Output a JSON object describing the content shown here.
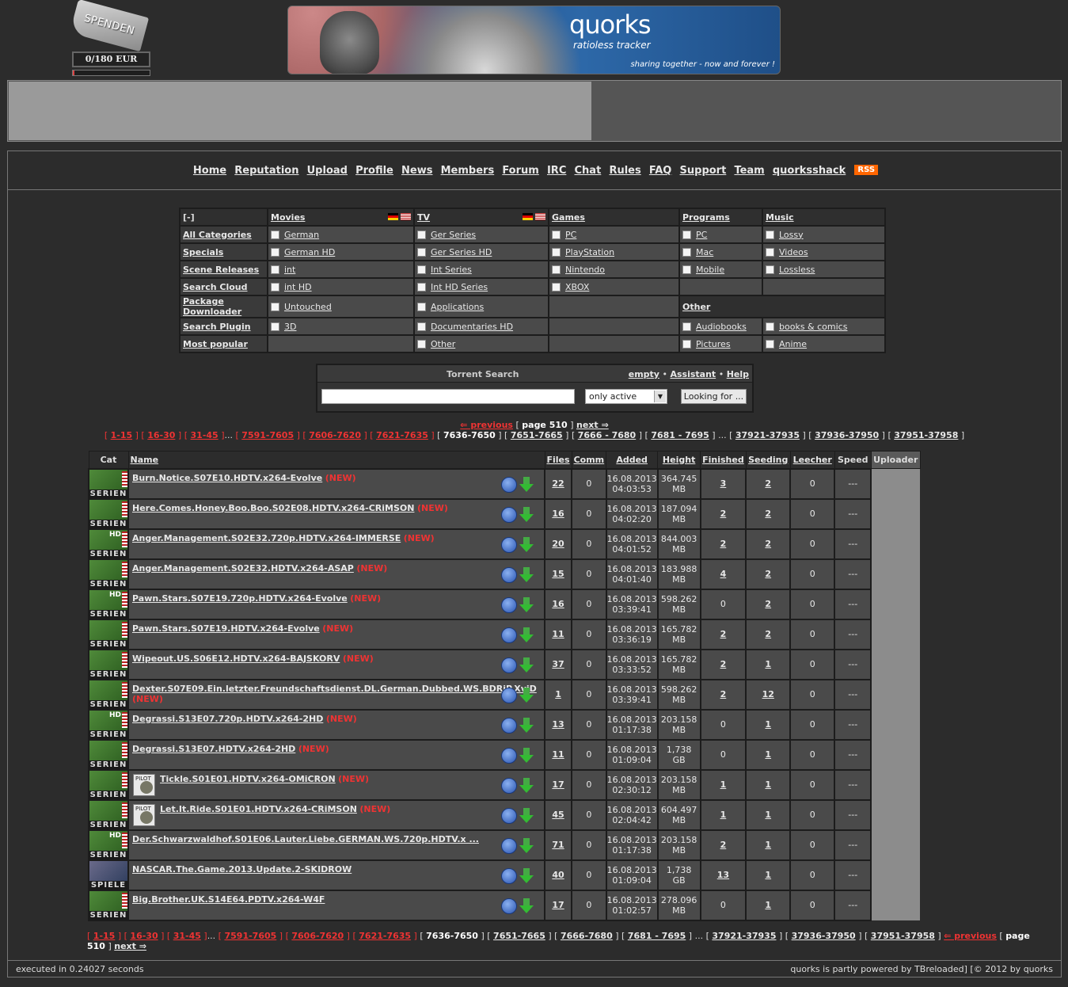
{
  "donate": {
    "tag": "SPENDEN",
    "amount": "0/180 EUR",
    "progress": 0.0
  },
  "banner": {
    "title": "quorks",
    "subtitle": "ratioless tracker",
    "slogan": "sharing together - now and forever !"
  },
  "nav": {
    "items": [
      "Home",
      "Reputation",
      "Upload",
      "Profile",
      "News",
      "Members",
      "Forum",
      "IRC",
      "Chat",
      "Rules",
      "FAQ",
      "Support",
      "Team",
      "quorksshack"
    ],
    "rss": "RSS"
  },
  "categories": {
    "toggle": "[-]",
    "headers": {
      "movies": "Movies",
      "tv": "TV",
      "games": "Games",
      "programs": "Programs",
      "music": "Music",
      "other": "Other"
    },
    "links": [
      "All Categories",
      "Specials",
      "Scene Releases",
      "Search Cloud",
      "Package Downloader",
      "Search Plugin",
      "Most popular"
    ],
    "movies": [
      "German",
      "German HD",
      "int",
      "int HD",
      "Untouched",
      "3D"
    ],
    "tv": [
      "Ger Series",
      "Ger Series HD",
      "Int Series",
      "Int HD Series",
      "Applications",
      "Documentaries HD",
      "Other"
    ],
    "games": [
      "PC",
      "PlayStation",
      "Nintendo",
      "XBOX"
    ],
    "programs": [
      "PC",
      "Mac",
      "Mobile"
    ],
    "music": [
      "Lossy",
      "Videos",
      "Lossless"
    ],
    "other_left": [
      "Audiobooks",
      "Pictures"
    ],
    "other_right": [
      "books & comics",
      "Anime"
    ]
  },
  "search": {
    "title": "Torrent Search",
    "empty": "empty",
    "assistant": "Assistant",
    "help": "Help",
    "sep": "•",
    "select_value": "only active",
    "button": "Looking for ..."
  },
  "pager": {
    "previous": "⇐ previous",
    "page": "page 510",
    "next": "next ⇒",
    "red_pages": [
      "1-15",
      "16-30",
      "31-45",
      "7591-7605",
      "7606-7620",
      "7621-7635"
    ],
    "current": "7636-7650",
    "top_pages": [
      "7651-7665",
      "7666 - 7680",
      "7681 - 7695",
      "37921-37935",
      "37936-37950",
      "37951-37958"
    ],
    "bottom_pages": [
      "7651-7665",
      "7666-7680",
      "7681 - 7695",
      "37921-37935",
      "37936-37950",
      "37951-37958"
    ],
    "ellipsis": "..."
  },
  "table": {
    "headers": [
      "Cat",
      "Name",
      "Files",
      "Comm",
      "Added",
      "Height",
      "Finished",
      "Seeding",
      "Leecher",
      "Speed",
      "Uploader"
    ],
    "new_label": "(NEW)",
    "rows": [
      {
        "cat": "SERIEN",
        "hd": "",
        "name": "Burn.Notice.S07E10.HDTV.x264-Evolve",
        "new": true,
        "files": "22",
        "comm": "0",
        "date": "16.08.2013",
        "time": "04:03:53",
        "size": "364.745",
        "unit": "MB",
        "finished": "3",
        "seeding": "2",
        "leecher": "0",
        "speed": "---"
      },
      {
        "cat": "SERIEN",
        "hd": "",
        "name": "Here.Comes.Honey.Boo.Boo.S02E08.HDTV.x264-CRiMSON",
        "new": true,
        "files": "16",
        "comm": "0",
        "date": "16.08.2013",
        "time": "04:02:20",
        "size": "187.094",
        "unit": "MB",
        "finished": "2",
        "seeding": "2",
        "leecher": "0",
        "speed": "---"
      },
      {
        "cat": "SERIEN",
        "hd": "HD",
        "name": "Anger.Management.S02E32.720p.HDTV.x264-IMMERSE",
        "new": true,
        "files": "20",
        "comm": "0",
        "date": "16.08.2013",
        "time": "04:01:52",
        "size": "844.003",
        "unit": "MB",
        "finished": "2",
        "seeding": "2",
        "leecher": "0",
        "speed": "---"
      },
      {
        "cat": "SERIEN",
        "hd": "",
        "name": "Anger.Management.S02E32.HDTV.x264-ASAP",
        "new": true,
        "files": "15",
        "comm": "0",
        "date": "16.08.2013",
        "time": "04:01:40",
        "size": "183.988",
        "unit": "MB",
        "finished": "4",
        "seeding": "2",
        "leecher": "0",
        "speed": "---"
      },
      {
        "cat": "SERIEN",
        "hd": "HD",
        "name": "Pawn.Stars.S07E19.720p.HDTV.x264-Evolve",
        "new": true,
        "files": "16",
        "comm": "0",
        "date": "16.08.2013",
        "time": "03:39:41",
        "size": "598.262",
        "unit": "MB",
        "finished": "0",
        "seeding": "2",
        "leecher": "0",
        "speed": "---"
      },
      {
        "cat": "SERIEN",
        "hd": "",
        "name": "Pawn.Stars.S07E19.HDTV.x264-Evolve",
        "new": true,
        "files": "11",
        "comm": "0",
        "date": "16.08.2013",
        "time": "03:36:19",
        "size": "165.782",
        "unit": "MB",
        "finished": "2",
        "seeding": "2",
        "leecher": "0",
        "speed": "---"
      },
      {
        "cat": "SERIEN",
        "hd": "",
        "name": "Wipeout.US.S06E12.HDTV.x264-BAJSKORV",
        "new": true,
        "files": "37",
        "comm": "0",
        "date": "16.08.2013",
        "time": "03:33:52",
        "size": "165.782",
        "unit": "MB",
        "finished": "2",
        "seeding": "1",
        "leecher": "0",
        "speed": "---"
      },
      {
        "cat": "SERIEN",
        "hd": "",
        "name": "Dexter.S07E09.Ein.letzter.Freundschaftsdienst.DL.German.Dubbed.WS.BDRiP.XviD",
        "new": true,
        "files": "1",
        "comm": "0",
        "date": "16.08.2013",
        "time": "03:39:41",
        "size": "598.262",
        "unit": "MB",
        "finished": "2",
        "seeding": "12",
        "leecher": "0",
        "speed": "---"
      },
      {
        "cat": "SERIEN",
        "hd": "HD",
        "name": "Degrassi.S13E07.720p.HDTV.x264-2HD",
        "new": true,
        "files": "13",
        "comm": "0",
        "date": "16.08.2013",
        "time": "01:17:38",
        "size": "203.158",
        "unit": "MB",
        "finished": "0",
        "seeding": "1",
        "leecher": "0",
        "speed": "---"
      },
      {
        "cat": "SERIEN",
        "hd": "",
        "name": "Degrassi.S13E07.HDTV.x264-2HD",
        "new": true,
        "files": "11",
        "comm": "0",
        "date": "16.08.2013",
        "time": "01:09:04",
        "size": "1,738",
        "unit": "GB",
        "finished": "0",
        "seeding": "1",
        "leecher": "0",
        "speed": "---"
      },
      {
        "cat": "SERIEN",
        "hd": "",
        "pilot": true,
        "name": "Tickle.S01E01.HDTV.x264-OMiCRON",
        "new": true,
        "files": "17",
        "comm": "0",
        "date": "16.08.2013",
        "time": "02:30:12",
        "size": "203.158",
        "unit": "MB",
        "finished": "1",
        "seeding": "1",
        "leecher": "0",
        "speed": "---"
      },
      {
        "cat": "SERIEN",
        "hd": "",
        "pilot": true,
        "name": "Let.It.Ride.S01E01.HDTV.x264-CRiMSON",
        "new": true,
        "files": "45",
        "comm": "0",
        "date": "16.08.2013",
        "time": "02:04:42",
        "size": "604.497",
        "unit": "MB",
        "finished": "1",
        "seeding": "1",
        "leecher": "0",
        "speed": "---"
      },
      {
        "cat": "SERIEN",
        "hd": "HD",
        "name": "Der.Schwarzwaldhof.S01E06.Lauter.Liebe.GERMAN.WS.720p.HDTV.x ...",
        "new": false,
        "files": "71",
        "comm": "0",
        "date": "16.08.2013",
        "time": "01:17:38",
        "size": "203.158",
        "unit": "MB",
        "finished": "2",
        "seeding": "1",
        "leecher": "0",
        "speed": "---"
      },
      {
        "cat": "SPIELE",
        "hd": "",
        "pc": true,
        "name": "NASCAR.The.Game.2013.Update.2-SKIDROW",
        "new": false,
        "files": "40",
        "comm": "0",
        "date": "16.08.2013",
        "time": "01:09:04",
        "size": "1,738",
        "unit": "GB",
        "finished": "13",
        "seeding": "1",
        "leecher": "0",
        "speed": "---"
      },
      {
        "cat": "SERIEN",
        "hd": "",
        "name": "Big.Brother.UK.S14E64.PDTV.x264-W4F",
        "new": false,
        "files": "17",
        "comm": "0",
        "date": "16.08.2013",
        "time": "01:02:57",
        "size": "278.096",
        "unit": "MB",
        "finished": "0",
        "seeding": "1",
        "leecher": "0",
        "speed": "---"
      }
    ]
  },
  "footer": {
    "left": "executed in 0.24027 seconds",
    "right": "quorks is partly powered by TBreloaded] [© 2012 by quorks"
  },
  "colors": {
    "background": "#2c2c2c",
    "cell": "#4a4a4a",
    "new": "#e33",
    "rss": "#f60"
  }
}
